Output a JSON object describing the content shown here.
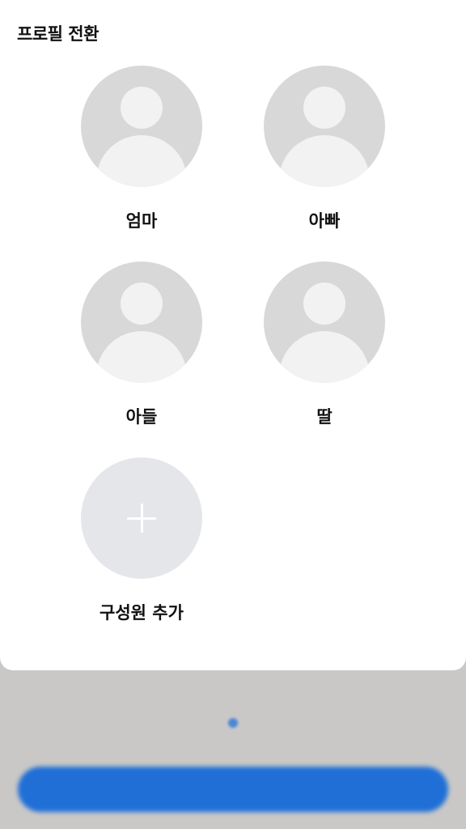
{
  "sheet": {
    "title": "프로필 전환"
  },
  "profiles": [
    {
      "name": "엄마",
      "icon": "person-avatar-icon"
    },
    {
      "name": "아빠",
      "icon": "person-avatar-icon"
    },
    {
      "name": "아들",
      "icon": "person-avatar-icon"
    },
    {
      "name": "딸",
      "icon": "person-avatar-icon"
    }
  ],
  "add_member": {
    "label": "구성원 추가",
    "icon": "plus-icon"
  },
  "background": {
    "cta_label": "",
    "page_indicator_color": "#4d86d6",
    "cta_color": "#1f6fd6"
  }
}
